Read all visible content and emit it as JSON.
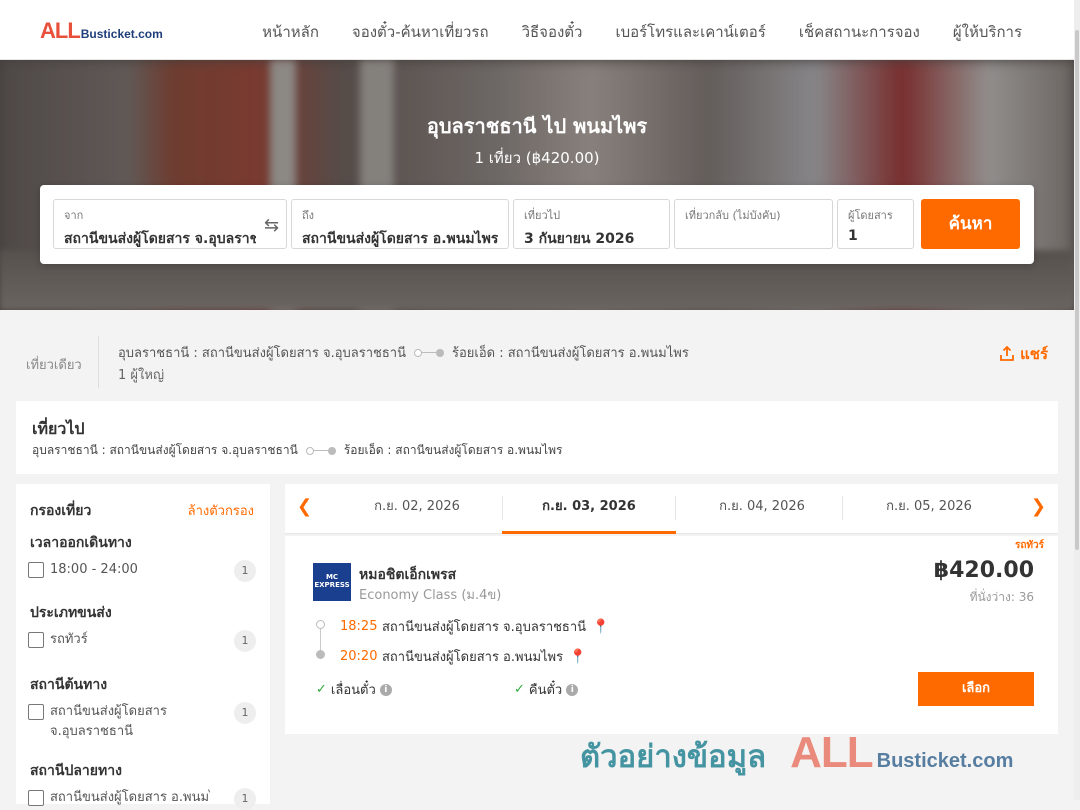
{
  "brand": {
    "logo_all": "ALL",
    "logo_rest": "Busticket.com",
    "accent": "#ff6a00"
  },
  "nav": {
    "items": [
      "หน้าหลัก",
      "จองตั๋ว-ค้นหาเที่ยวรถ",
      "วิธีจองตั๋ว",
      "เบอร์โทรและเคาน์เตอร์",
      "เช็คสถานะการจอง",
      "ผู้ให้บริการ"
    ]
  },
  "hero": {
    "title": "อุบลราชธานี ไป พนมไพร",
    "subtitle": "1 เที่ยว (฿420.00)"
  },
  "search": {
    "from_label": "จาก",
    "from_value": "สถานีขนส่งผู้โดยสาร จ.อุบลราชธานี",
    "to_label": "ถึง",
    "to_value": "สถานีขนส่งผู้โดยสาร อ.พนมไพร",
    "depart_label": "เที่ยวไป",
    "depart_value": "3 กันยายน 2026",
    "return_label": "เที่ยวกลับ (ไม่บังคับ)",
    "return_value": "",
    "pax_label": "ผู้โดยสาร",
    "pax_value": "1",
    "button": "ค้นหา"
  },
  "trip": {
    "type": "เที่ยวเดียว",
    "origin": "อุบลราชธานี : สถานีขนส่งผู้โดยสาร จ.อุบลราชธานี",
    "destination": "ร้อยเอ็ด : สถานีขนส่งผู้โดยสาร อ.พนมไพร",
    "passengers": "1 ผู้ใหญ่",
    "share": "แชร์"
  },
  "departure": {
    "heading": "เที่ยวไป",
    "origin": "อุบลราชธานี : สถานีขนส่งผู้โดยสาร จ.อุบลราชธานี",
    "destination": "ร้อยเอ็ด : สถานีขนส่งผู้โดยสาร อ.พนมไพร"
  },
  "filters": {
    "title": "กรองเที่ยว",
    "clear": "ล้างตัวกรอง",
    "sections": [
      {
        "title": "เวลาออกเดินทาง",
        "options": [
          {
            "label": "18:00 - 24:00",
            "count": "1"
          }
        ]
      },
      {
        "title": "ประเภทขนส่ง",
        "options": [
          {
            "label": "รถทัวร์",
            "count": "1"
          }
        ]
      },
      {
        "title": "สถานีต้นทาง",
        "options": [
          {
            "label": "สถานีขนส่งผู้โดยสาร จ.อุบลราชธานี",
            "count": "1"
          }
        ]
      },
      {
        "title": "สถานีปลายทาง",
        "options": [
          {
            "label": "สถานีขนส่งผู้โดยสาร อ.พนมไพร",
            "count": "1"
          }
        ]
      }
    ]
  },
  "dates": {
    "tabs": [
      "ก.ย. 02, 2026",
      "ก.ย. 03, 2026",
      "ก.ย. 04, 2026",
      "ก.ย. 05, 2026"
    ],
    "active_index": 1
  },
  "result": {
    "vehicle_tag": "รถทัวร์",
    "operator": "หมอชิตเอ็กเพรส",
    "operator_logo_text": "MC EXPRESS",
    "class": "Economy Class (ม.4ข)",
    "price": "฿420.00",
    "seats": "ที่นั่งว่าง: 36",
    "depart_time": "18:25",
    "depart_station": "สถานีขนส่งผู้โดยสาร จ.อุบลราชธานี",
    "arrive_time": "20:20",
    "arrive_station": "สถานีขนส่งผู้โดยสาร อ.พนมไพร",
    "policy1": "เลื่อนตั๋ว",
    "policy2": "คืนตั๋ว",
    "select": "เลือก"
  },
  "watermark": {
    "text": "ตัวอย่างข้อมูล",
    "logo_all": "ALL",
    "logo_rest": "Busticket.com"
  }
}
